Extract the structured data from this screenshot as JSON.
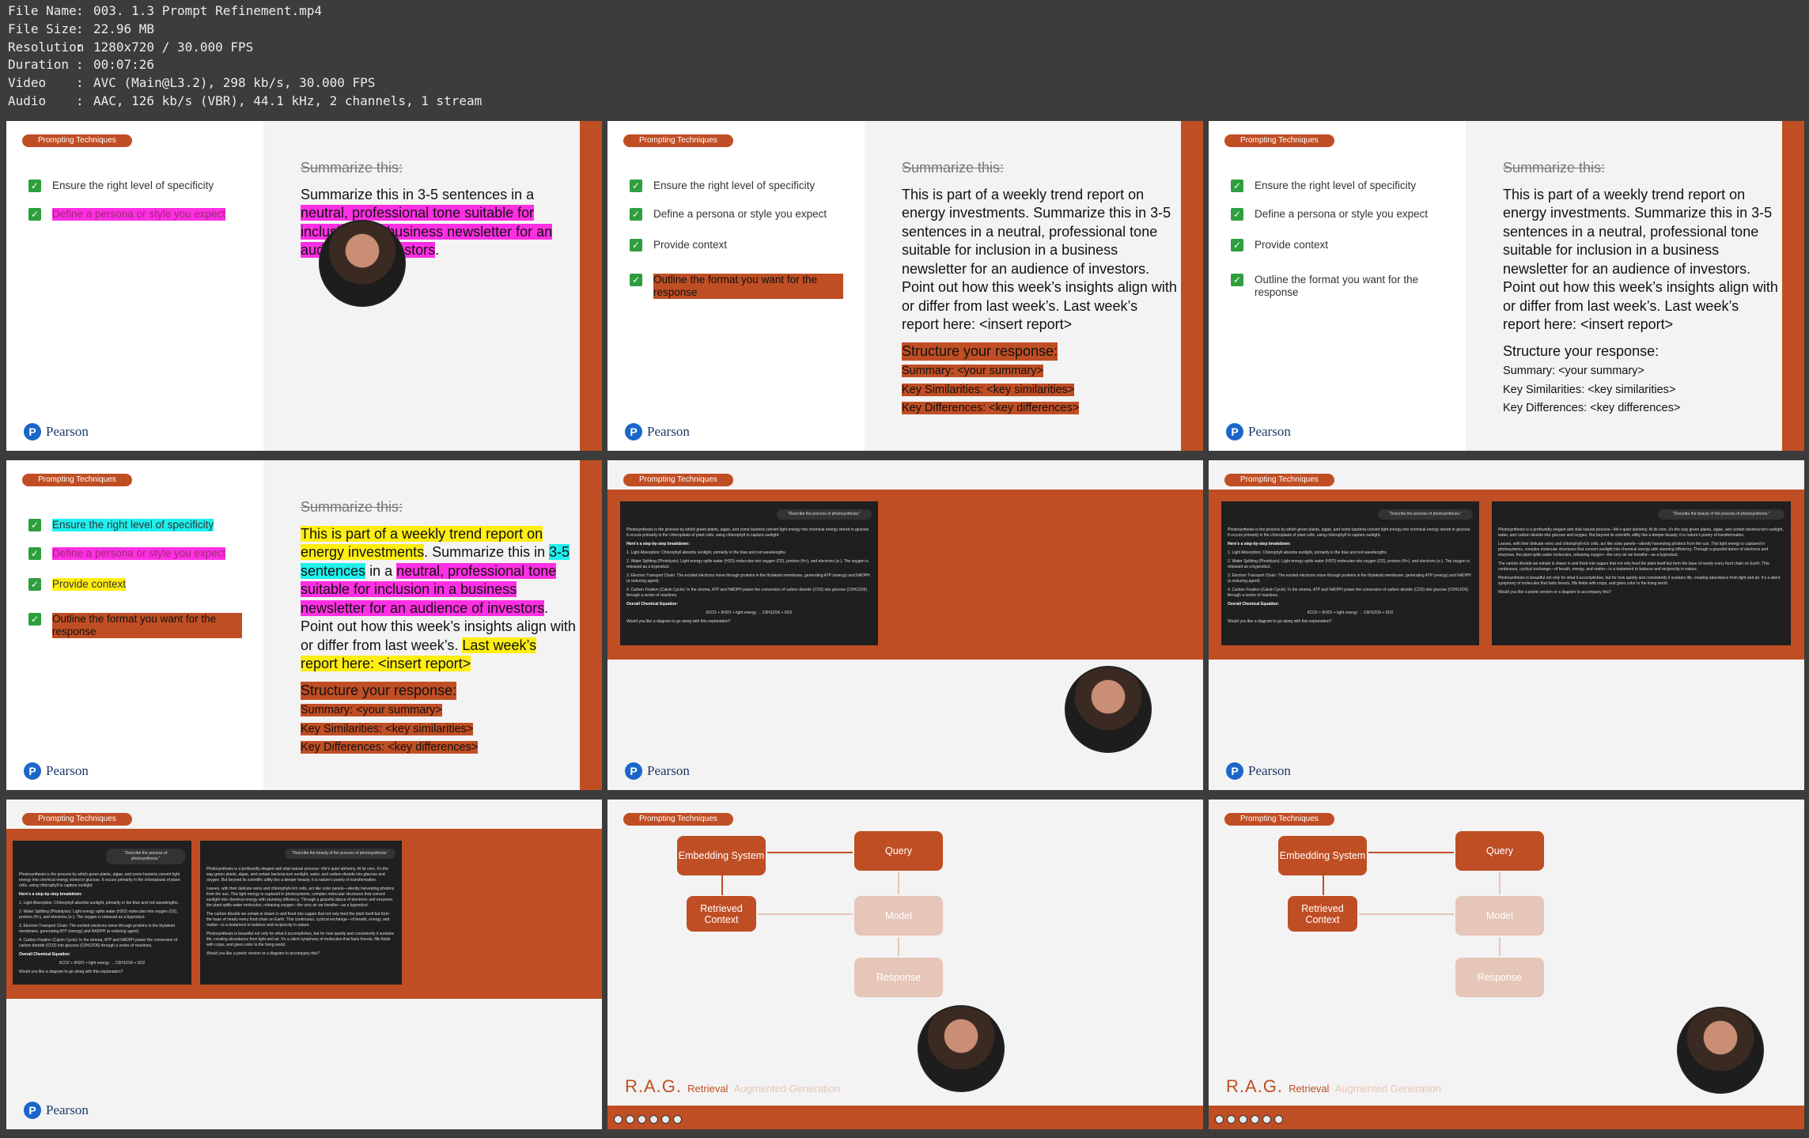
{
  "info": {
    "rows": [
      {
        "k": "File Name",
        "v": "003. 1.3 Prompt Refinement.mp4"
      },
      {
        "k": "File Size",
        "v": "22.96 MB"
      },
      {
        "k": "Resolution",
        "v": "1280x720 / 30.000 FPS"
      },
      {
        "k": "Duration",
        "v": "00:07:26"
      },
      {
        "k": "Video",
        "v": "AVC (Main@L3.2), 298 kb/s, 30.000 FPS"
      },
      {
        "k": "Audio",
        "v": "AAC, 126 kb/s (VBR), 44.1 kHz, 2 channels, 1 stream"
      }
    ]
  },
  "common": {
    "pill": "Prompting Techniques",
    "brand": "Pearson",
    "brand_letter": "P",
    "check": "✓"
  },
  "checklist": {
    "i1": "Ensure the right level of specificity",
    "i2": "Define a persona or style you expect",
    "i3": "Provide context",
    "i4": "Outline the format you want for the response"
  },
  "prompt": {
    "strike": "Summarize this:",
    "f1_a": "Summarize this in 3-5 sentences in a ",
    "f1_b": "neutral, professional tone suitable for inclusion in a business newsletter for an audience of investors",
    "f1_c": ".",
    "long": "This is part of a weekly trend report on energy investments. Summarize this in 3-5 sentences in a neutral, professional tone suitable for inclusion in a business newsletter for an audience of investors. Point out how this week’s insights align with or differ from last week’s. Last week’s report here: <insert report>",
    "f4_a": "This is part of a weekly trend report on energy investments",
    "f4_b": ". Summarize this in ",
    "f4_c": "3-5 sentences",
    "f4_d": " in a ",
    "f4_e": "neutral, professional tone suitable for inclusion in a business newsletter for an audience of investors",
    "f4_f": ". Point out how this week’s insights align with or differ from last week’s. ",
    "f4_g": "Last week’s report here: <insert report>",
    "structure": "Structure your response:",
    "s1": "Summary: <your summary>",
    "s2": "Key Similarities: <key similarities>",
    "s3": "Key Differences: <key differences>"
  },
  "chat1": {
    "q": "\"Describe the process of photosynthesis.\"",
    "p1": "Photosynthesis is the process by which green plants, algae, and some bacteria convert light energy into chemical energy stored in glucose. It occurs primarily in the chloroplasts of plant cells, using chlorophyll to capture sunlight.",
    "h": "Here’s a step-by-step breakdown:",
    "l1": "1. Light Absorption: Chlorophyll absorbs sunlight, primarily in the blue and red wavelengths.",
    "l2": "2. Water Splitting (Photolysis): Light energy splits water (H2O) molecules into oxygen (O2), protons (H+), and electrons (e-). The oxygen is released as a byproduct.",
    "l3": "3. Electron Transport Chain: The excited electrons move through proteins in the thylakoid membrane, generating ATP (energy) and NADPH (a reducing agent).",
    "l4": "4. Carbon Fixation (Calvin Cycle): In the stroma, ATP and NADPH power the conversion of carbon dioxide (CO2) into glucose (C6H12O6) through a series of reactions.",
    "eqh": "Overall Chemical Equation:",
    "eq": "6CO2 + 6H2O + light energy → C6H12O6 + 6O2",
    "end": "Would you like a diagram to go along with this explanation?"
  },
  "chat2": {
    "q": "\"Describe the beauty of the process of photosynthesis.\"",
    "p1": "Photosynthesis is a profoundly elegant and vital natural process—life’s quiet alchemy. At its core, it’s the way green plants, algae, and certain bacteria turn sunlight, water, and carbon dioxide into glucose and oxygen. But beyond its scientific utility lies a deeper beauty: it is nature’s poetry of transformation.",
    "p2": "Leaves, with their delicate veins and chlorophyll-rich cells, act like solar panels—silently harvesting photons from the sun. This light energy is captured in photosystems, complex molecular structures that convert sunlight into chemical energy with stunning efficiency. Through a graceful dance of electrons and enzymes, the plant splits water molecules, releasing oxygen—the very air we breathe—as a byproduct.",
    "p3": "The carbon dioxide we exhale is drawn in and fixed into sugars that not only feed the plant itself but form the base of nearly every food chain on Earth. This continuous, cyclical exchange—of breath, energy, and matter—is a testament to balance and reciprocity in nature.",
    "p4": "Photosynthesis is beautiful not only for what it accomplishes, but for how quietly and consistently it sustains life, creating abundance from light and air. It’s a silent symphony of molecules that fuels forests, fills fields with crops, and gives color to the living world.",
    "end": "Would you like a poetic version or a diagram to accompany this?"
  },
  "rag": {
    "embedding": "Embedding System",
    "query": "Query",
    "retrieved": "Retrieved Context",
    "model": "Model",
    "response": "Response",
    "title_r": "R",
    "title_rest": ".A.G.",
    "title_w1": "Retrieval",
    "title_w2": "Augmented Generation"
  }
}
